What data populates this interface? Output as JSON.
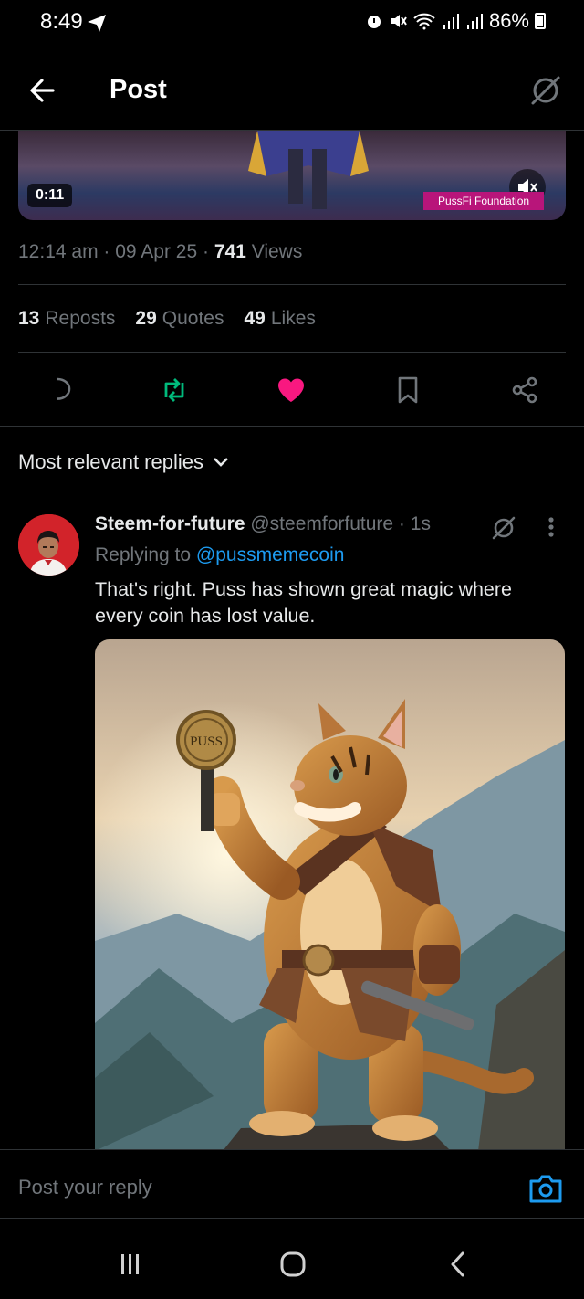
{
  "status_bar": {
    "time": "8:49",
    "battery": "86%"
  },
  "header": {
    "title": "Post"
  },
  "video": {
    "duration": "0:11",
    "watermark": "PussFi Foundation"
  },
  "meta": {
    "time": "12:14 am",
    "date": "09 Apr 25",
    "views_count": "741",
    "views_label": "Views"
  },
  "stats": {
    "reposts_count": "13",
    "reposts_label": "Reposts",
    "quotes_count": "29",
    "quotes_label": "Quotes",
    "likes_count": "49",
    "likes_label": "Likes"
  },
  "actions": {
    "like_color": "#f91880",
    "repost_color": "#00ba7c"
  },
  "sort": {
    "label": "Most relevant replies"
  },
  "reply": {
    "name": "Steem-for-future",
    "handle": "@steemforfuture",
    "time": "1s",
    "replying_prefix": "Replying to",
    "replying_to": "@pussmemecoin",
    "text": "That's right. Puss has shown great magic where every coin has lost value.",
    "image_coin_text": "PUSS"
  },
  "compose": {
    "placeholder": "Post your reply"
  }
}
